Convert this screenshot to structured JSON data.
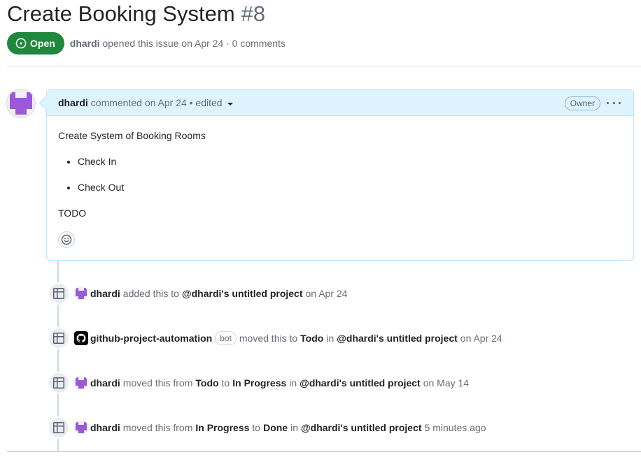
{
  "issue": {
    "title": "Create Booking System",
    "number": "#8",
    "state": "Open",
    "author": "dhardi",
    "opened_text": "opened this issue on Apr 24 · 0 comments"
  },
  "comment": {
    "author": "dhardi",
    "meta": "commented on Apr 24 • edited",
    "badge": "Owner",
    "body": {
      "intro": "Create System of Booking Rooms",
      "items": [
        "Check In",
        "Check Out"
      ],
      "outro": "TODO"
    }
  },
  "timeline": [
    {
      "actor": "dhardi",
      "parts": [
        "added this to",
        "@dhardi's untitled project",
        "on Apr 24"
      ]
    },
    {
      "actor": "github-project-automation",
      "badge": "bot",
      "parts": [
        "moved this to",
        "Todo",
        "in",
        "@dhardi's untitled project",
        "on Apr 24"
      ]
    },
    {
      "actor": "dhardi",
      "parts": [
        "moved this from",
        "Todo",
        "to",
        "In Progress",
        "in",
        "@dhardi's untitled project",
        "on May 14"
      ]
    },
    {
      "actor": "dhardi",
      "parts": [
        "moved this from",
        "In Progress",
        "to",
        "Done",
        "in",
        "@dhardi's untitled project",
        "5 minutes ago"
      ]
    }
  ],
  "icons": {
    "state": "issue-opened-icon",
    "avatar": "identicon-avatar",
    "bot_avatar": "github-logo-icon",
    "event": "table-project-icon",
    "reaction": "smiley-icon",
    "kebab": "kebab-horizontal-icon"
  },
  "colors": {
    "open_green": "#1f883d",
    "comment_header_bg": "#ddf4ff",
    "comment_border": "#b6e3ff",
    "identicon": "#9b59d8"
  }
}
